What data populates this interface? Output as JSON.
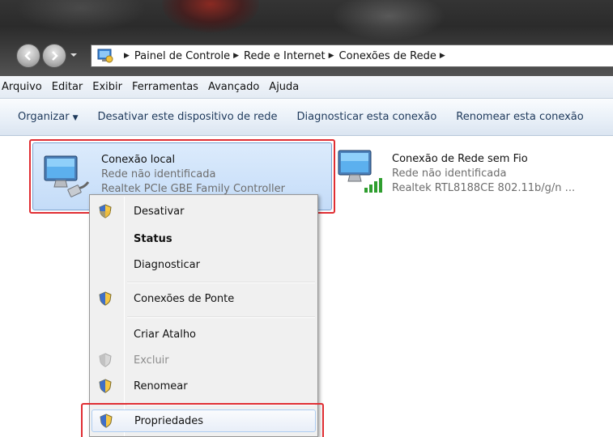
{
  "address": {
    "breadcrumbs": [
      "Painel de Controle",
      "Rede e Internet",
      "Conexões de Rede"
    ]
  },
  "menubar": {
    "items": [
      "Arquivo",
      "Editar",
      "Exibir",
      "Ferramentas",
      "Avançado",
      "Ajuda"
    ]
  },
  "commandbar": {
    "organize": "Organizar",
    "disable": "Desativar este dispositivo de rede",
    "diagnose": "Diagnosticar esta conexão",
    "rename": "Renomear esta conexão"
  },
  "connections": [
    {
      "name": "Conexão local",
      "status": "Rede não identificada",
      "adapter": "Realtek PCIe GBE Family Controller",
      "icon": "wired-network-icon",
      "selected": true
    },
    {
      "name": "Conexão de Rede sem Fio",
      "status": "Rede não identificada",
      "adapter": "Realtek RTL8188CE 802.11b/g/n ...",
      "icon": "wireless-network-icon",
      "selected": false
    }
  ],
  "context_menu": {
    "items": [
      {
        "label": "Desativar",
        "shield": true,
        "bold": false,
        "disabled": false
      },
      {
        "label": "Status",
        "shield": false,
        "bold": true,
        "disabled": false
      },
      {
        "label": "Diagnosticar",
        "shield": false,
        "bold": false,
        "disabled": false
      },
      {
        "label": "Conexões de Ponte",
        "shield": true,
        "bold": false,
        "disabled": false
      },
      {
        "label": "Criar Atalho",
        "shield": false,
        "bold": false,
        "disabled": false
      },
      {
        "label": "Excluir",
        "shield": true,
        "bold": false,
        "disabled": true
      },
      {
        "label": "Renomear",
        "shield": true,
        "bold": false,
        "disabled": false
      },
      {
        "label": "Propriedades",
        "shield": true,
        "bold": false,
        "disabled": false,
        "hovered": true
      }
    ]
  },
  "colors": {
    "highlight_box": "#e02e33",
    "selection_fill": "#c4dcf8",
    "command_text": "#1e395b"
  }
}
